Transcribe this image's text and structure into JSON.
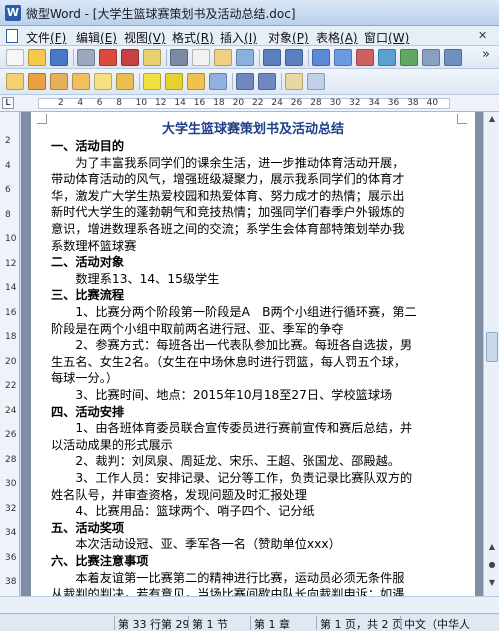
{
  "window": {
    "title": "微型Word - [大学生篮球赛策划书及活动总结.doc]",
    "app_icon": "W"
  },
  "menu": {
    "items": [
      {
        "label": "文件",
        "key": "(F)"
      },
      {
        "label": "编辑",
        "key": "(E)"
      },
      {
        "label": "视图",
        "key": "(V)"
      },
      {
        "label": "格式",
        "key": "(R)"
      },
      {
        "label": "插入",
        "key": "(I)"
      },
      {
        "label": "对象",
        "key": "(P)"
      },
      {
        "label": "表格",
        "key": "(A)"
      },
      {
        "label": "窗口",
        "key": "(W)"
      }
    ]
  },
  "toolbar1_icons": [
    "new-icon",
    "open-icon",
    "save-icon",
    "print-icon",
    "print-preview-icon",
    "pdf-icon",
    "copy-format-icon",
    "cut-icon",
    "copy-icon",
    "paste-icon",
    "find-icon",
    "undo-icon",
    "redo-icon",
    "table-icon",
    "insert-table-icon",
    "columns-icon",
    "frame-icon",
    "image-icon",
    "zoom-icon",
    "doc-map-icon"
  ],
  "toolbar2_icons": [
    "edit-doc-icon",
    "insert-doc-icon",
    "delete-doc-icon",
    "replace-doc-icon",
    "copy-doc-icon",
    "paste-doc-icon",
    "highlight-icon",
    "marker-icon",
    "pen-icon",
    "comment-icon",
    "undo2-icon",
    "redo2-icon",
    "note-icon",
    "more-icon"
  ],
  "ruler": {
    "numbers": [
      "2",
      "4",
      "6",
      "8",
      "10",
      "12",
      "14",
      "16",
      "18",
      "20",
      "22",
      "24",
      "26",
      "28",
      "30",
      "32",
      "34",
      "36",
      "38",
      "40"
    ]
  },
  "vruler": {
    "numbers": [
      "2",
      "4",
      "6",
      "8",
      "10",
      "12",
      "14",
      "16",
      "18",
      "20",
      "22",
      "24",
      "26",
      "28",
      "30",
      "32",
      "34",
      "36",
      "38"
    ]
  },
  "document": {
    "title": "大学生篮球赛策划书及活动总结",
    "lines": [
      {
        "text": "一、活动目的",
        "heading": true
      },
      {
        "text": "　　为了丰富我系同学们的课余生活，进一步推动体育活动开展，"
      },
      {
        "text": "带动体育活动的风气，增强班级凝聚力，展示我系同学们的体育才"
      },
      {
        "text": "华，激发广大学生热爱校园和热爱体育、努力成才的热情；展示出"
      },
      {
        "text": "新时代大学生的蓬勃朝气和竞技热情；加强同学们春季户外锻炼的"
      },
      {
        "text": "意识，增进数理系各班之间的交流；系学生会体育部特策划举办我"
      },
      {
        "text": "系数理杯篮球赛"
      },
      {
        "text": "二、活动对象",
        "heading": true
      },
      {
        "text": "　　数理系13、14、15级学生"
      },
      {
        "text": "三、比赛流程",
        "heading": true
      },
      {
        "text": "　　1、比赛分两个阶段第一阶段是A　B两个小组进行循环赛，第二"
      },
      {
        "text": "阶段是在两个小组中取前两名进行冠、亚、季军的争夺"
      },
      {
        "text": "　　2、参赛方式：每班各出一代表队参加比赛。每班各自选拔，男"
      },
      {
        "text": "生五名、女生2名。（女生在中场休息时进行罚篮，每人罚五个球，"
      },
      {
        "text": "每球一分。）"
      },
      {
        "text": "　　3、比赛时间、地点：2015年10月18至27日、学校篮球场"
      },
      {
        "text": "四、活动安排",
        "heading": true
      },
      {
        "text": "　　1、由各班体育委员联合宣传委员进行赛前宣传和赛后总结，并"
      },
      {
        "text": "以活动成果的形式展示"
      },
      {
        "text": "　　2、裁判：刘凤泉、周延龙、宋乐、王超、张国龙、邵殿越。"
      },
      {
        "text": "　　3、工作人员：安排记录、记分等工作，负责记录比赛队双方的"
      },
      {
        "text": "姓名队号，并审查资格，发现问题及时汇报处理"
      },
      {
        "text": "　　4、比赛用品：篮球两个、哨子四个、记分纸"
      },
      {
        "text": "五、活动奖项",
        "heading": true
      },
      {
        "text": "　　本次活动设冠、亚、季军各一名（赞助单位xxx）"
      },
      {
        "text": "六、比赛注意事项",
        "heading": true
      },
      {
        "text": "　　本着友谊第一比赛第二的精神进行比赛，运动员必须无条件服"
      },
      {
        "text": "从裁判的判决，若有意见，当场比赛间歇由队长向裁判申诉；如遇"
      }
    ]
  },
  "status": {
    "line_col": "第 33 行第 29",
    "section": "第 1 节",
    "chapter": "第 1 章",
    "page": "第 1 页，共 2 页",
    "language": "中文（中华人"
  }
}
